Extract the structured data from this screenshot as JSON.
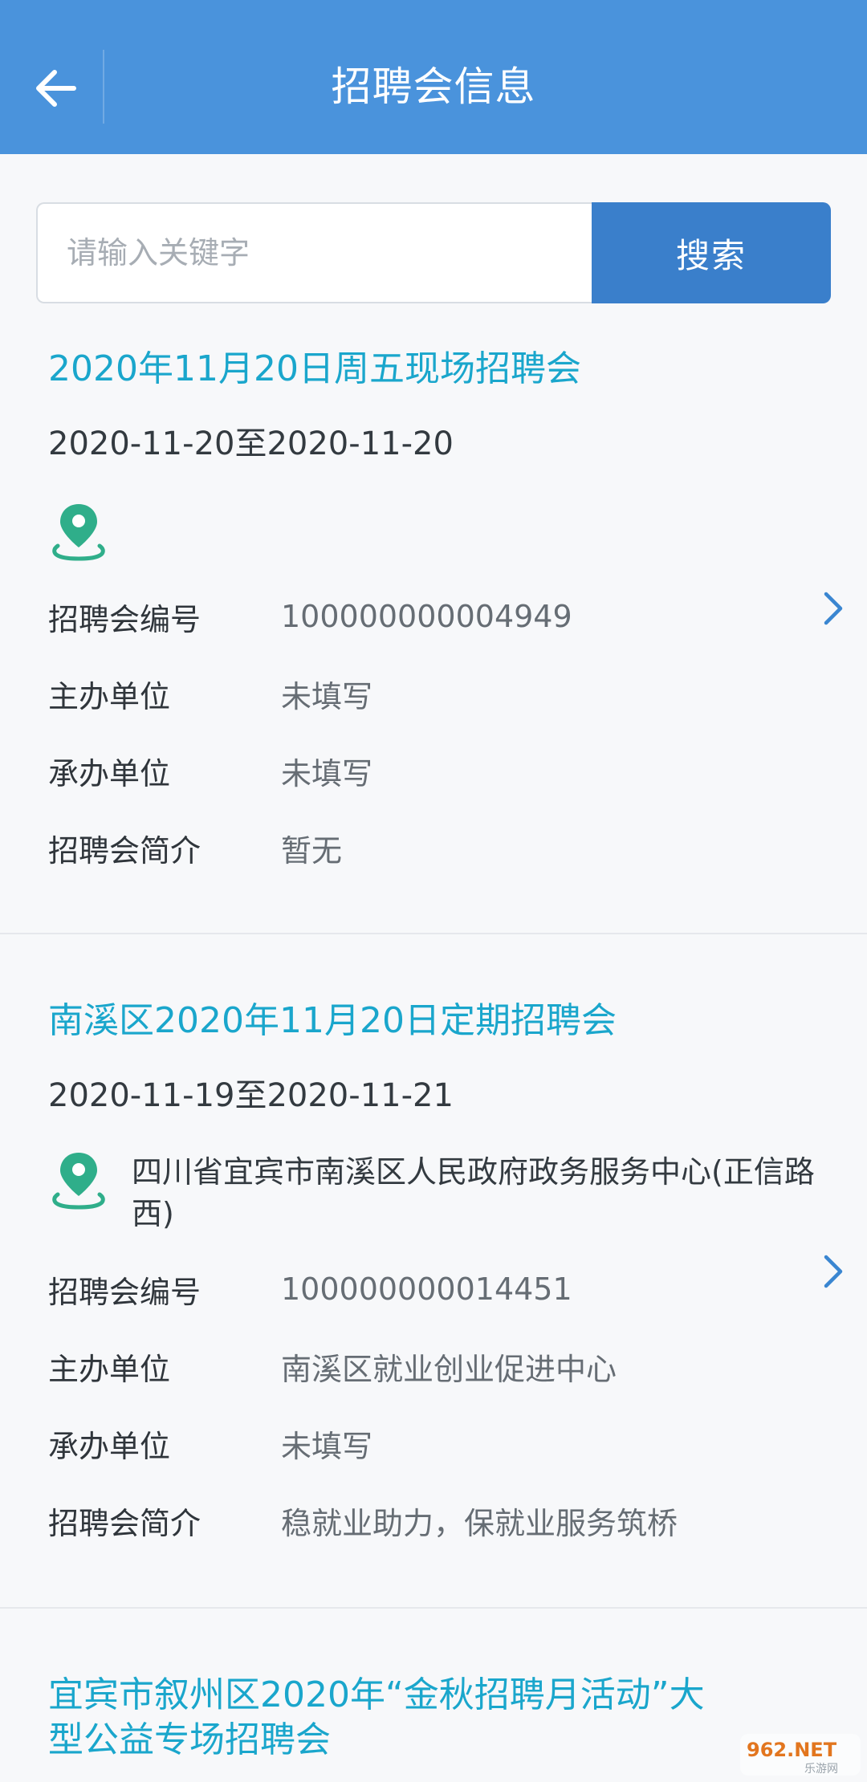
{
  "header": {
    "title": "招聘会信息"
  },
  "search": {
    "placeholder": "请输入关键字",
    "button_label": "搜索"
  },
  "cards": [
    {
      "title": "2020年11月20日周五现场招聘会",
      "date_range": "2020-11-20至2020-11-20",
      "location": "",
      "fields": [
        {
          "label": "招聘会编号",
          "value": "100000000004949"
        },
        {
          "label": "主办单位",
          "value": "未填写"
        },
        {
          "label": "承办单位",
          "value": "未填写"
        },
        {
          "label": "招聘会简介",
          "value": "暂无"
        }
      ]
    },
    {
      "title": "南溪区2020年11月20日定期招聘会",
      "date_range": "2020-11-19至2020-11-21",
      "location": "四川省宜宾市南溪区人民政府政务服务中心(正信路西)",
      "fields": [
        {
          "label": "招聘会编号",
          "value": "100000000014451"
        },
        {
          "label": "主办单位",
          "value": "南溪区就业创业促进中心"
        },
        {
          "label": "承办单位",
          "value": "未填写"
        },
        {
          "label": "招聘会简介",
          "value": "稳就业助力，保就业服务筑桥"
        }
      ]
    },
    {
      "title_line1": "宜宾市叙州区2020年“金秋招聘月活动”大",
      "title_line2": "型公益专场招聘会"
    }
  ],
  "colors": {
    "header_bg": "#4a93dc",
    "search_button": "#3a7fcb",
    "title_link": "#1aa6cc",
    "location_icon": "#2fae8a",
    "chevron": "#3a86d1"
  },
  "icons": [
    "back-arrow-icon",
    "location-pin-icon",
    "chevron-right-icon"
  ],
  "watermark": {
    "main": "962.NET",
    "sub": "乐游网"
  }
}
